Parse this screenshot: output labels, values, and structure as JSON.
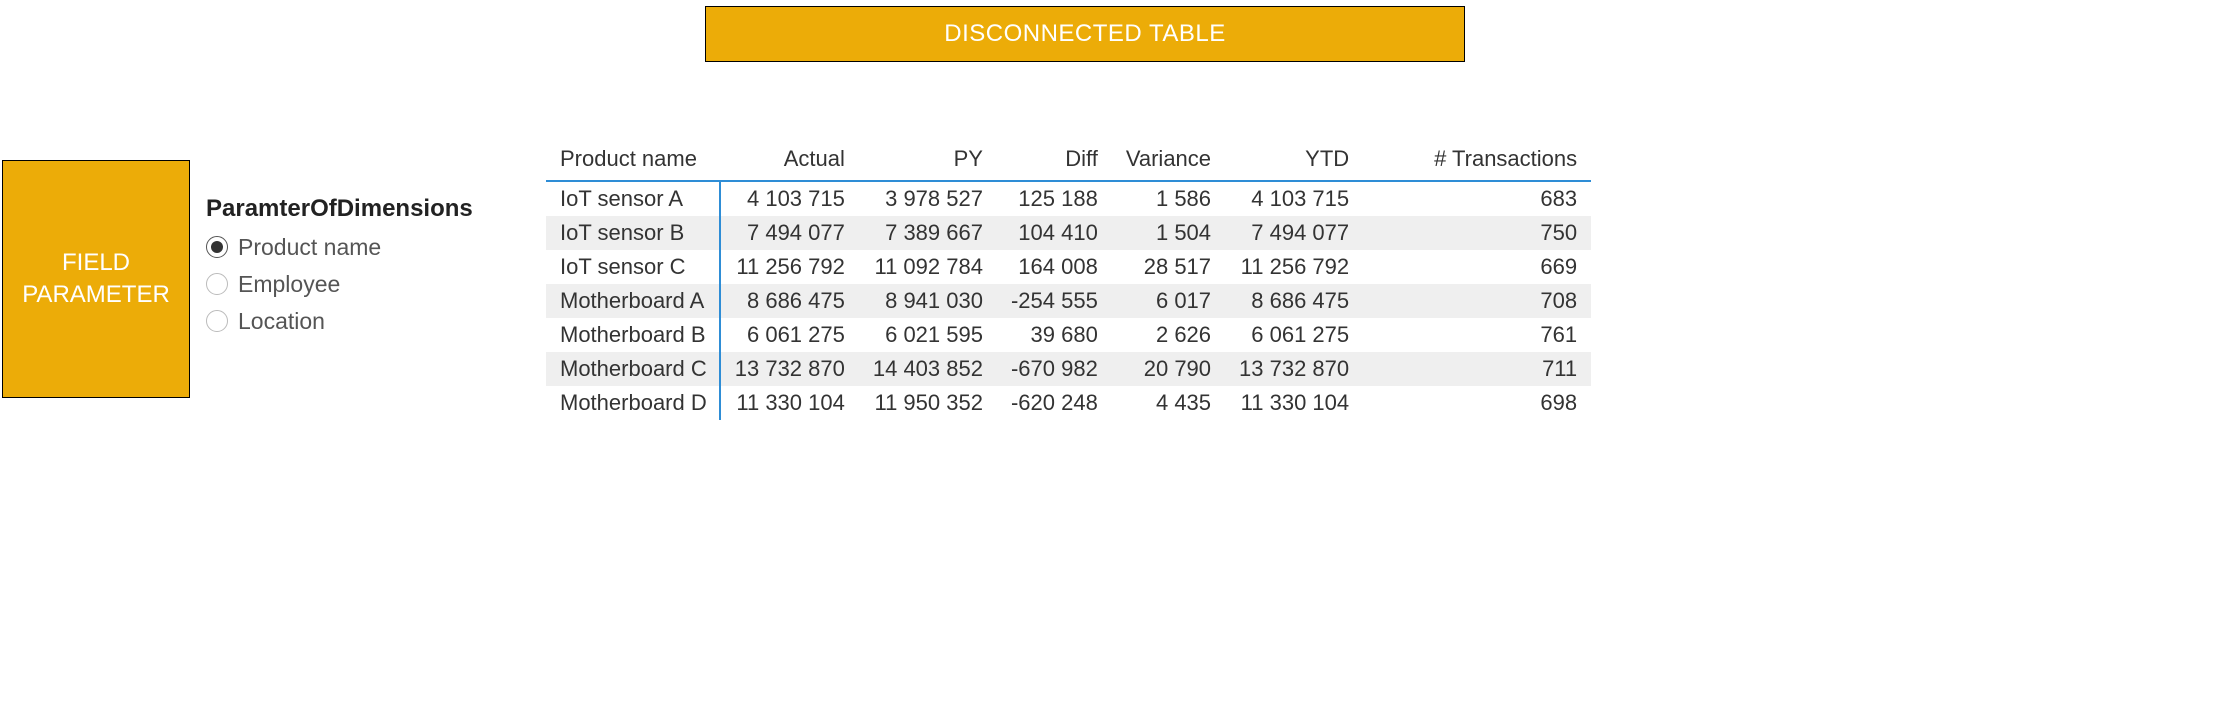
{
  "banners": {
    "top": "DISCONNECTED TABLE",
    "left": "FIELD PARAMETER"
  },
  "slicer": {
    "title": "ParamterOfDimensions",
    "options": [
      {
        "label": "Product name",
        "selected": true
      },
      {
        "label": "Employee",
        "selected": false
      },
      {
        "label": "Location",
        "selected": false
      }
    ]
  },
  "matrix": {
    "columns": [
      {
        "label": "Product name",
        "kind": "rowhdr"
      },
      {
        "label": "Actual",
        "kind": "num"
      },
      {
        "label": "PY",
        "kind": "num"
      },
      {
        "label": "Diff",
        "kind": "num"
      },
      {
        "label": "Variance",
        "kind": "num"
      },
      {
        "label": "YTD",
        "kind": "num"
      },
      {
        "label": "# Transactions",
        "kind": "num"
      }
    ],
    "rows": [
      {
        "name": "IoT sensor A",
        "actual": "4 103 715",
        "py": "3 978 527",
        "diff": "125 188",
        "variance": "1 586",
        "ytd": "4 103 715",
        "txn": "683"
      },
      {
        "name": "IoT sensor B",
        "actual": "7 494 077",
        "py": "7 389 667",
        "diff": "104 410",
        "variance": "1 504",
        "ytd": "7 494 077",
        "txn": "750"
      },
      {
        "name": "IoT sensor C",
        "actual": "11 256 792",
        "py": "11 092 784",
        "diff": "164 008",
        "variance": "28 517",
        "ytd": "11 256 792",
        "txn": "669"
      },
      {
        "name": "Motherboard A",
        "actual": "8 686 475",
        "py": "8 941 030",
        "diff": "-254 555",
        "variance": "6 017",
        "ytd": "8 686 475",
        "txn": "708"
      },
      {
        "name": "Motherboard B",
        "actual": "6 061 275",
        "py": "6 021 595",
        "diff": "39 680",
        "variance": "2 626",
        "ytd": "6 061 275",
        "txn": "761"
      },
      {
        "name": "Motherboard C",
        "actual": "13 732 870",
        "py": "14 403 852",
        "diff": "-670 982",
        "variance": "20 790",
        "ytd": "13 732 870",
        "txn": "711"
      },
      {
        "name": "Motherboard D",
        "actual": "11 330 104",
        "py": "11 950 352",
        "diff": "-620 248",
        "variance": "4 435",
        "ytd": "11 330 104",
        "txn": "698"
      }
    ]
  }
}
